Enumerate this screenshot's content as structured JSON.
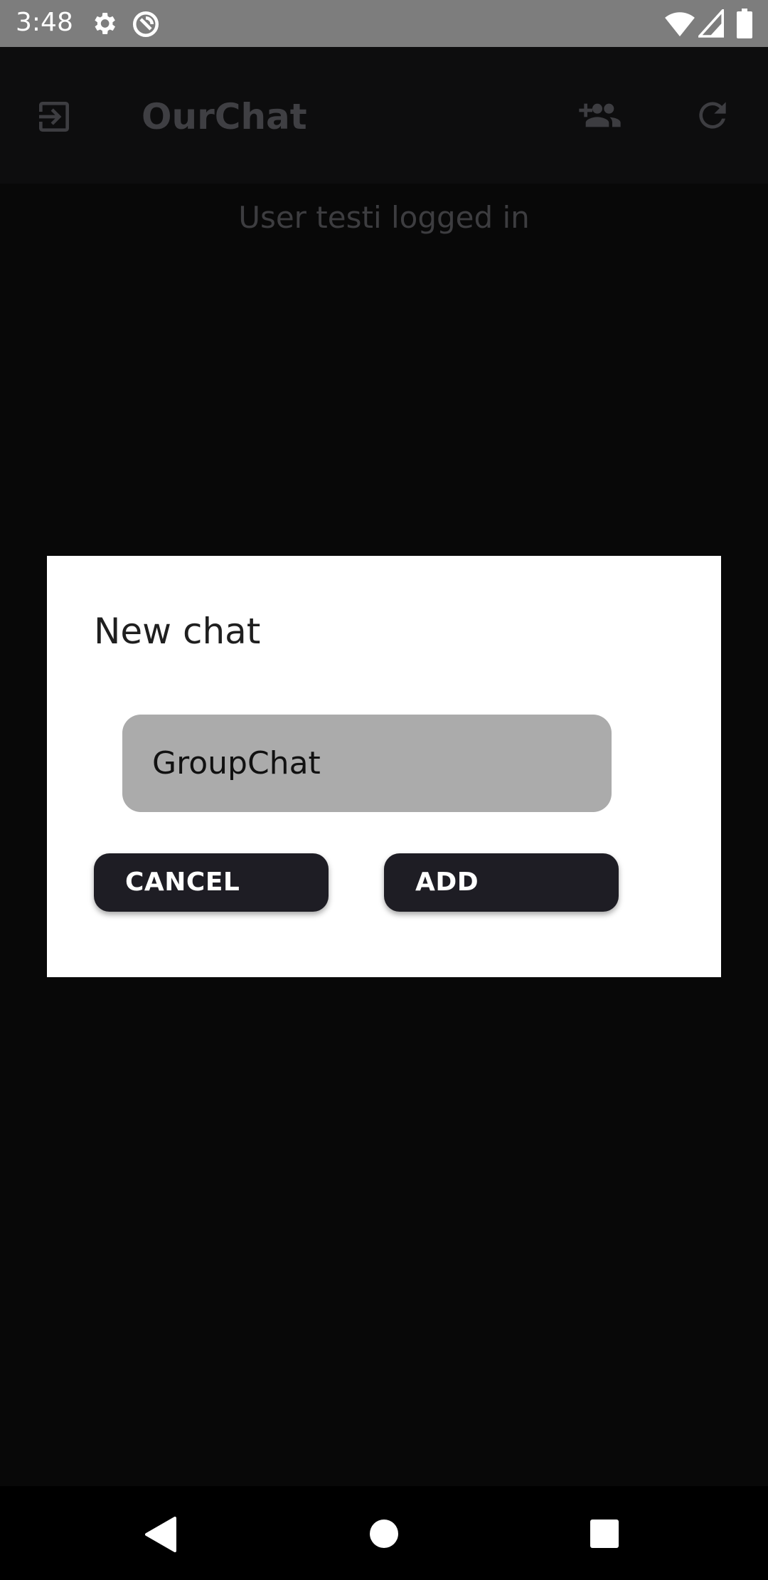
{
  "status_bar": {
    "time": "3:48",
    "icons": [
      "gear-icon",
      "sync-disabled-icon",
      "wifi-icon",
      "signal-icon",
      "battery-icon"
    ]
  },
  "app_bar": {
    "title": "OurChat",
    "icons": [
      "logout-icon",
      "add-group-icon",
      "refresh-icon"
    ]
  },
  "main": {
    "status_message": "User testi logged in"
  },
  "dialog": {
    "title": "New chat",
    "input": {
      "value": "GroupChat"
    },
    "cancel_label": "CANCEL",
    "add_label": "ADD"
  },
  "nav_bar": {
    "icons": [
      "back-icon",
      "home-icon",
      "recents-icon"
    ]
  },
  "colors": {
    "status_bar_bg": "#7d7d7d",
    "app_bg": "#080808",
    "dialog_bg": "#ffffff",
    "input_bg": "#ababab",
    "button_bg": "#1e1d24"
  }
}
